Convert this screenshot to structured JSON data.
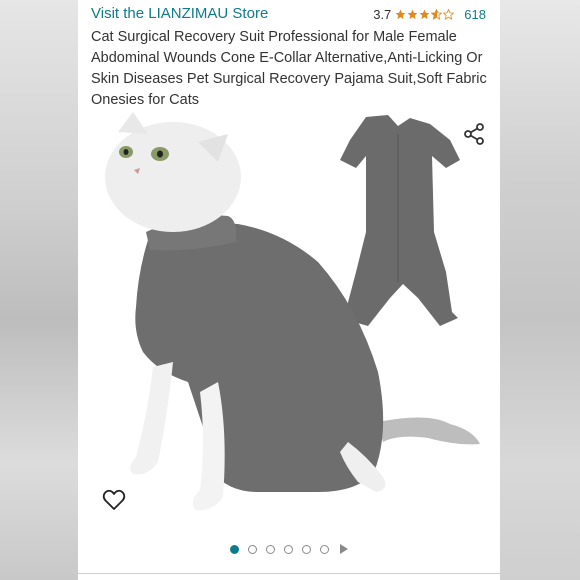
{
  "store": {
    "link_text": "Visit the LIANZIMAU Store"
  },
  "rating": {
    "value": "3.7",
    "stars": 3.7,
    "count": "618"
  },
  "product": {
    "title": "Cat Surgical Recovery Suit Professional for Male Female Abdominal Wounds Cone E-Collar Alternative,Anti-Licking Or Skin Diseases Pet Surgical Recovery Pajama Suit,Soft Fabric Onesies for Cats"
  },
  "carousel": {
    "total_dots": 6,
    "active_index": 0
  },
  "colors": {
    "link": "#0f7a8a",
    "star": "#e08a1e",
    "suit": "#6b6b6b"
  },
  "icons": {
    "share": "share-icon",
    "favorite": "heart-icon",
    "play": "play-icon"
  }
}
